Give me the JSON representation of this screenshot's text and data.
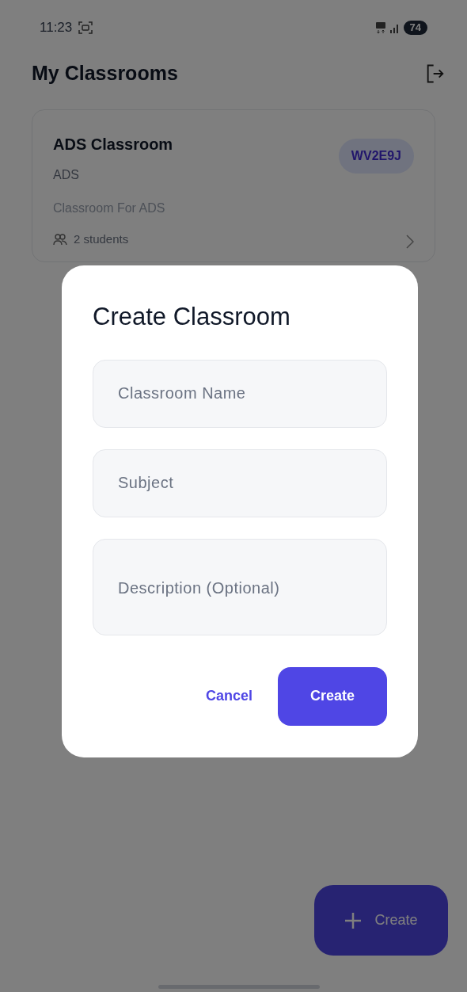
{
  "status_bar": {
    "time": "11:23",
    "battery": "74"
  },
  "header": {
    "title": "My Classrooms"
  },
  "classrooms": [
    {
      "name": "ADS Classroom",
      "subject": "ADS",
      "description": "Classroom For ADS",
      "code": "WV2E9J",
      "students": "2 students"
    }
  ],
  "fab": {
    "label": "Create"
  },
  "dialog": {
    "title": "Create Classroom",
    "fields": [
      {
        "placeholder": "Classroom Name",
        "kind": "single"
      },
      {
        "placeholder": "Subject",
        "kind": "single"
      },
      {
        "placeholder": "Description (Optional)",
        "kind": "multi"
      }
    ],
    "cancel": "Cancel",
    "submit": "Create"
  }
}
